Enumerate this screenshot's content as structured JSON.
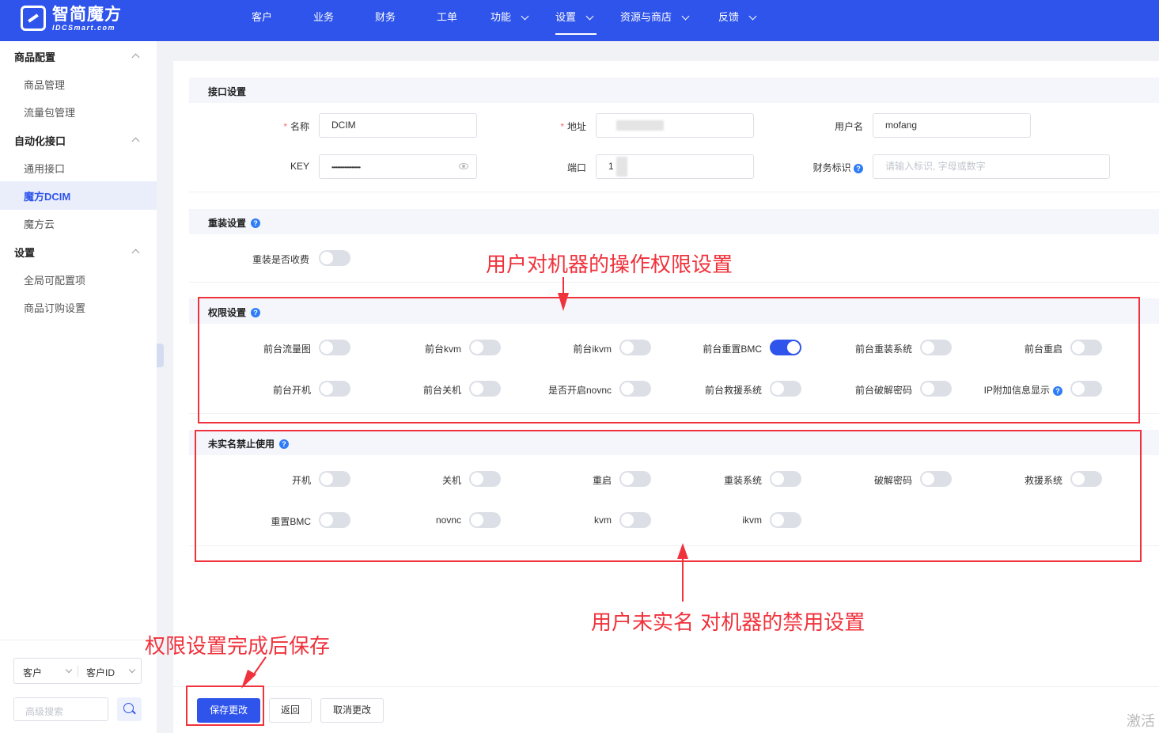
{
  "brand": {
    "title": "智简魔方",
    "subtitle": "IDCSmart.com"
  },
  "nav": [
    {
      "label": "客户",
      "dropdown": false
    },
    {
      "label": "业务",
      "dropdown": false
    },
    {
      "label": "财务",
      "dropdown": false
    },
    {
      "label": "工单",
      "dropdown": false
    },
    {
      "label": "功能",
      "dropdown": true
    },
    {
      "label": "设置",
      "dropdown": true,
      "active": true
    },
    {
      "label": "资源与商店",
      "dropdown": true
    },
    {
      "label": "反馈",
      "dropdown": true
    }
  ],
  "sidebar": {
    "groups": [
      {
        "label": "商品配置",
        "items": [
          "商品管理",
          "流量包管理"
        ]
      },
      {
        "label": "自动化接口",
        "items": [
          "通用接口",
          "魔方DCIM",
          "魔方云"
        ]
      },
      {
        "label": "设置",
        "items": [
          "全局可配置项",
          "商品订购设置"
        ]
      }
    ],
    "active_item": "魔方DCIM",
    "filter_select_1": "客户",
    "filter_select_2": "客户ID",
    "search_placeholder": "高级搜索"
  },
  "interface": {
    "title": "接口设置",
    "name_label": "名称",
    "name_value": "DCIM",
    "address_label": "地址",
    "username_label": "用户名",
    "username_value": "mofang",
    "key_label": "KEY",
    "key_value": "••••••••••••••••••••",
    "port_label": "端口",
    "port_value": "1",
    "finance_label": "财务标识",
    "finance_placeholder": "请输入标识, 字母或数字"
  },
  "reinstall": {
    "title": "重装设置",
    "toggle_label": "重装是否收费",
    "toggle_on": false
  },
  "permissions": {
    "title": "权限设置",
    "toggles": [
      {
        "label": "前台流量图",
        "on": false
      },
      {
        "label": "前台kvm",
        "on": false
      },
      {
        "label": "前台ikvm",
        "on": false
      },
      {
        "label": "前台重置BMC",
        "on": true
      },
      {
        "label": "前台重装系统",
        "on": false
      },
      {
        "label": "前台重启",
        "on": false
      },
      {
        "label": "前台开机",
        "on": false
      },
      {
        "label": "前台关机",
        "on": false
      },
      {
        "label": "是否开启novnc",
        "on": false
      },
      {
        "label": "前台救援系统",
        "on": false
      },
      {
        "label": "前台破解密码",
        "on": false
      },
      {
        "label": "IP附加信息显示",
        "on": false,
        "help": true
      }
    ]
  },
  "unverified": {
    "title": "未实名禁止使用",
    "toggles": [
      {
        "label": "开机",
        "on": false
      },
      {
        "label": "关机",
        "on": false
      },
      {
        "label": "重启",
        "on": false
      },
      {
        "label": "重装系统",
        "on": false
      },
      {
        "label": "破解密码",
        "on": false
      },
      {
        "label": "救援系统",
        "on": false
      },
      {
        "label": "重置BMC",
        "on": false
      },
      {
        "label": "novnc",
        "on": false
      },
      {
        "label": "kvm",
        "on": false
      },
      {
        "label": "ikvm",
        "on": false
      }
    ]
  },
  "footer": {
    "save": "保存更改",
    "back": "返回",
    "cancel": "取消更改"
  },
  "annotations": {
    "permissions_note": "用户对机器的操作权限设置",
    "unverified_note": "用户未实名 对机器的禁用设置",
    "save_note": "权限设置完成后保存"
  },
  "watermark": "激活",
  "colors": {
    "primary": "#2f54eb",
    "annotation": "#f0323c",
    "switch_off": "#dcdfe6"
  }
}
